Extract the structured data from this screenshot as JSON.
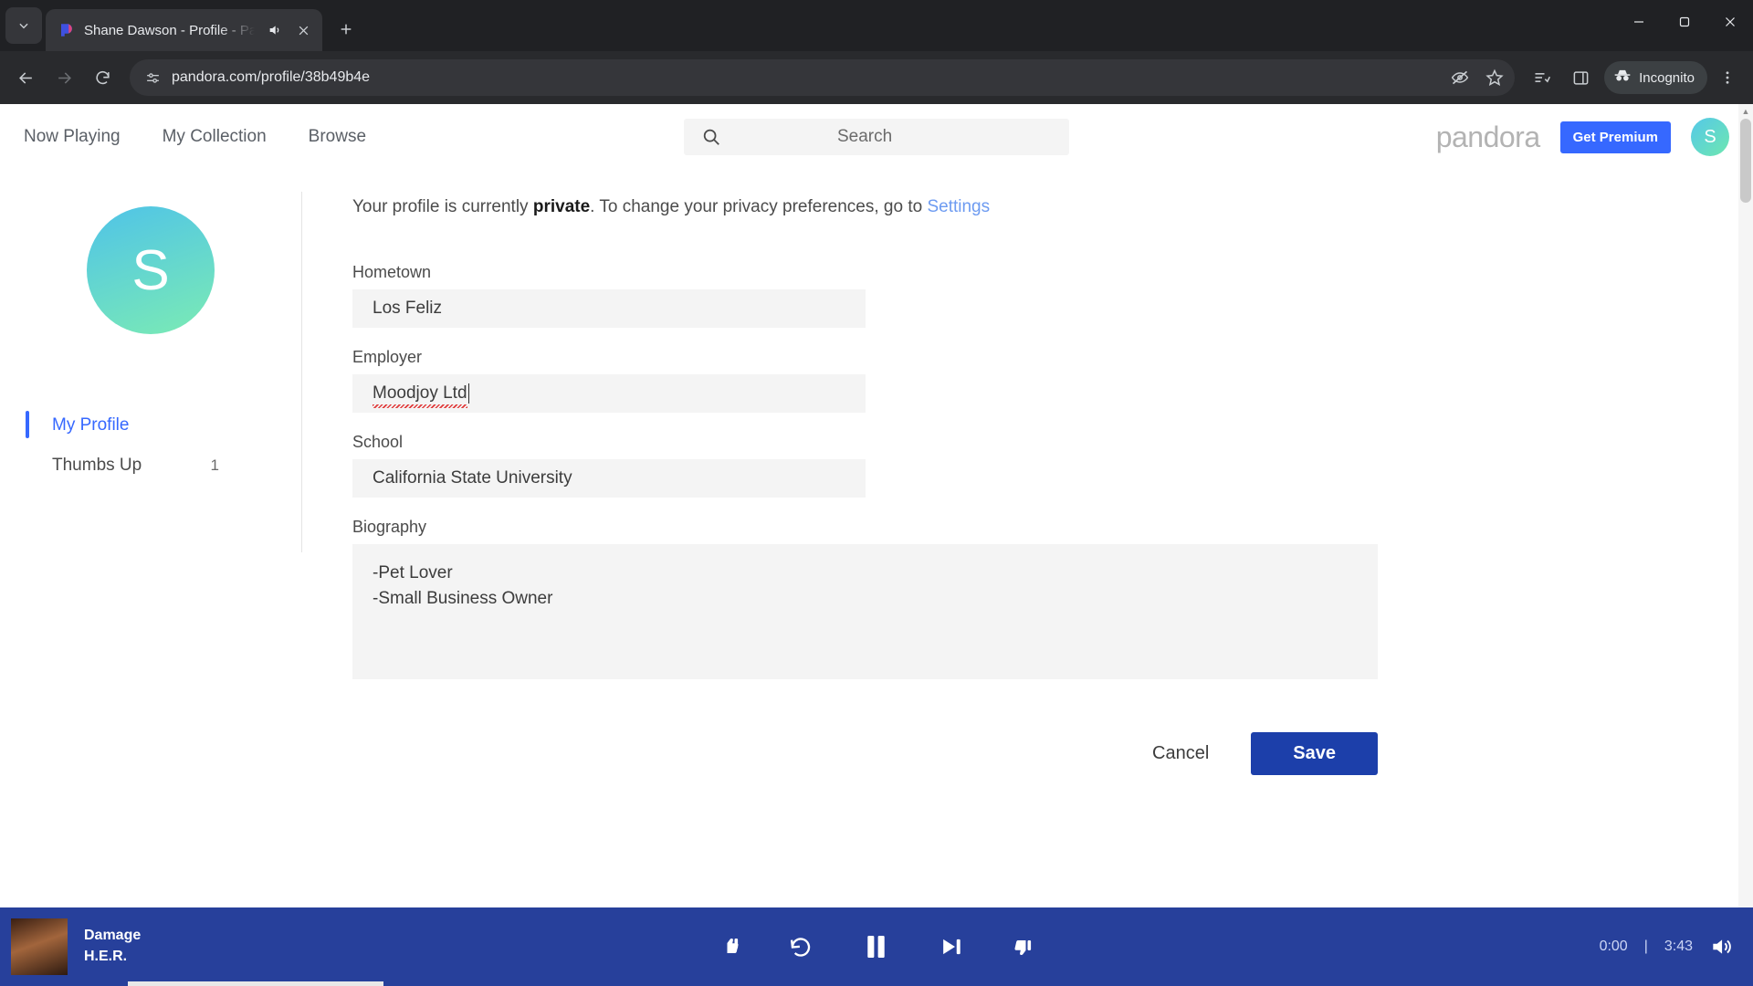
{
  "browser": {
    "tab": {
      "title": "Shane Dawson - Profile - Pa",
      "favicon_name": "pandora-favicon",
      "audio_icon": "speaker-icon",
      "close_icon": "close-icon"
    },
    "new_tab_label": "+",
    "window_controls": {
      "minimize": "—",
      "maximize": "☐",
      "close": "✕"
    },
    "nav": {
      "back": "back-arrow",
      "forward": "forward-arrow",
      "reload": "reload-icon"
    },
    "omnibox": {
      "url": "pandora.com/profile/38b49b4e",
      "site_icon": "site-settings-icon",
      "icons": [
        "third-party-cookie-blocked-icon",
        "bookmark-star-icon"
      ]
    },
    "toolbar_icons": [
      "reading-list-icon",
      "side-panel-icon"
    ],
    "incognito_label": "Incognito",
    "menu_icon": "kebab-menu-icon"
  },
  "site": {
    "nav_links": [
      {
        "label": "Now Playing"
      },
      {
        "label": "My Collection"
      },
      {
        "label": "Browse"
      }
    ],
    "search": {
      "placeholder": "Search",
      "icon": "search-icon"
    },
    "logo_text": "pandora",
    "premium_button": "Get Premium",
    "avatar_initial": "S"
  },
  "profile": {
    "avatar_initial": "S",
    "side_nav": [
      {
        "label": "My Profile",
        "count": "",
        "active": true
      },
      {
        "label": "Thumbs Up",
        "count": "1",
        "active": false
      }
    ]
  },
  "form": {
    "privacy": {
      "prefix": "Your profile is currently ",
      "status": "private",
      "middle": ". To change your privacy preferences, go to ",
      "link": "Settings"
    },
    "fields": [
      {
        "label": "Hometown",
        "value": "Los Feliz",
        "misspelled": false
      },
      {
        "label": "Employer",
        "value": "Moodjoy Ltd",
        "misspelled": true,
        "focused": true
      },
      {
        "label": "School",
        "value": "California State University",
        "misspelled": false
      }
    ],
    "biography": {
      "label": "Biography",
      "line1": "-Pet Lover",
      "line2": "-Small Business Owner"
    },
    "cancel_label": "Cancel",
    "save_label": "Save"
  },
  "player": {
    "track": "Damage",
    "artist": "H.E.R.",
    "elapsed": "0:00",
    "separator": "|",
    "duration": "3:43",
    "controls": [
      {
        "name": "thumb-down-icon"
      },
      {
        "name": "replay-icon"
      },
      {
        "name": "pause-icon"
      },
      {
        "name": "skip-next-icon"
      },
      {
        "name": "thumb-up-icon"
      }
    ],
    "volume_icon": "volume-icon"
  },
  "colors": {
    "accent_blue": "#3668ff",
    "player_bg": "#27409b",
    "save_button": "#1c3faa",
    "link": "#6d9bf1"
  }
}
